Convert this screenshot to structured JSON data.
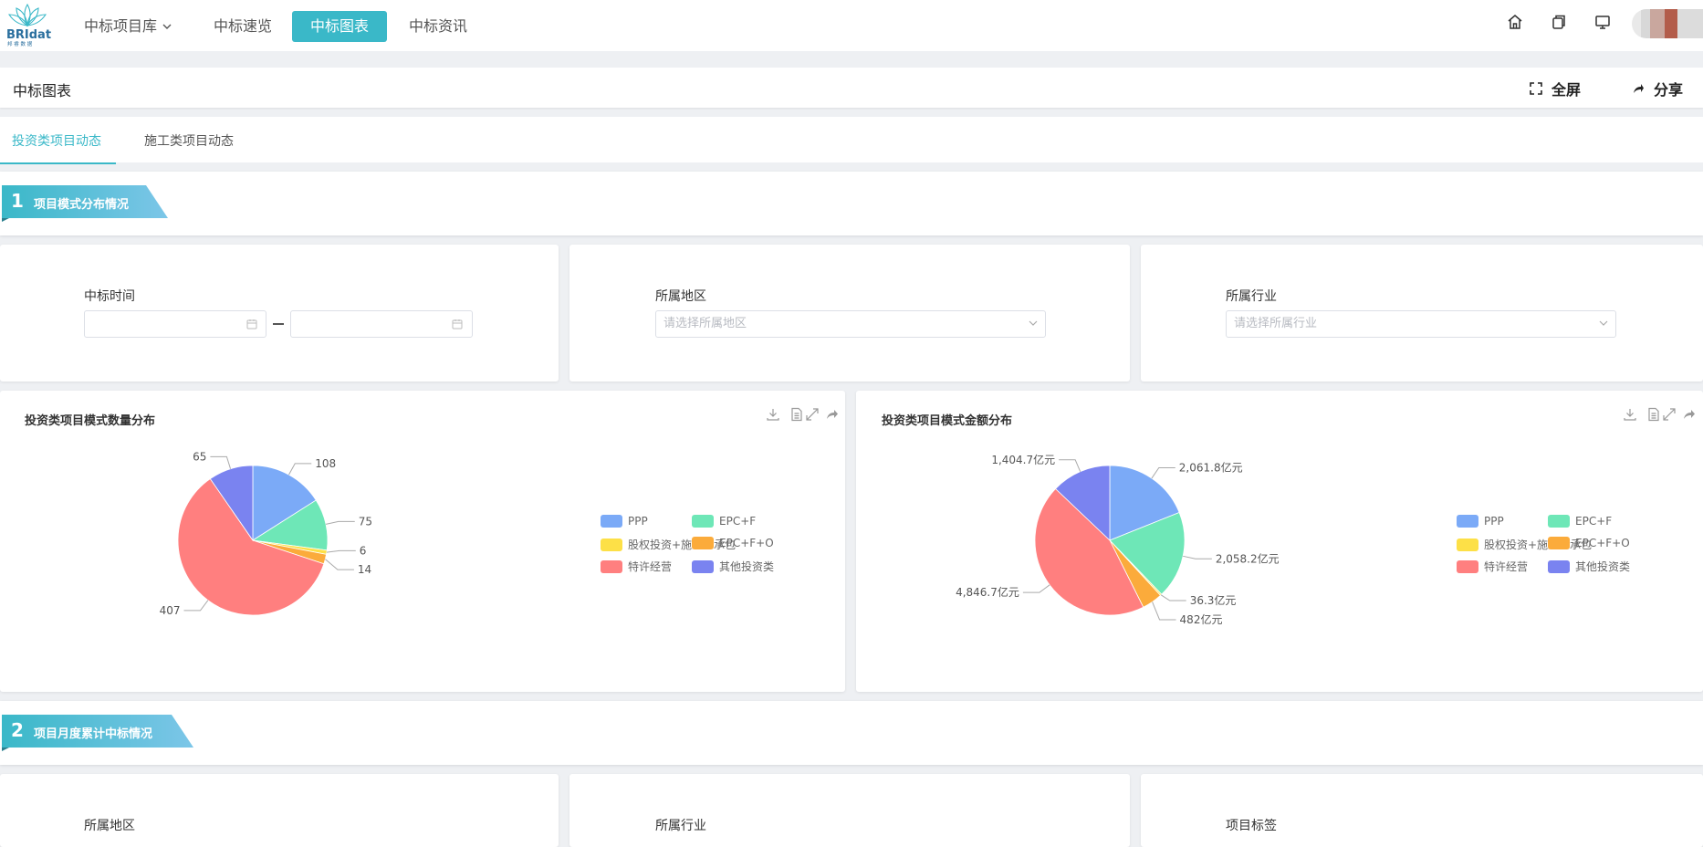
{
  "logo": {
    "text": "BRIdata",
    "subtext": "邦 睿 数 据"
  },
  "nav": {
    "items": [
      {
        "label": "中标项目库",
        "has_caret": true
      },
      {
        "label": "中标速览"
      },
      {
        "label": "中标图表",
        "active": true
      },
      {
        "label": "中标资讯"
      }
    ],
    "right_icons": [
      "home-icon",
      "copy-icon",
      "monitor-icon"
    ],
    "accent": "#3ab8c8"
  },
  "header": {
    "title": "中标图表",
    "fullscreen_label": "全屏",
    "share_label": "分享"
  },
  "tabs": [
    {
      "label": "投资类项目动态",
      "active": true
    },
    {
      "label": "施工类项目动态"
    }
  ],
  "sections": [
    {
      "num": "1",
      "title": "项目模式分布情况"
    },
    {
      "num": "2",
      "title": "项目月度累计中标情况"
    }
  ],
  "filters1": {
    "time_label": "中标时间",
    "start_value": "",
    "end_value": "",
    "region_label": "所属地区",
    "region_placeholder": "请选择所属地区",
    "industry_label": "所属行业",
    "industry_placeholder": "请选择所属行业"
  },
  "filters2": {
    "region_label": "所属地区",
    "industry_label": "所属行业",
    "tag_label": "项目标签"
  },
  "chart_data": [
    {
      "type": "pie",
      "title": "投资类项目模式数量分布",
      "categories": [
        "PPP",
        "EPC+F",
        "股权投资+施工总承包",
        "EPC+F+O",
        "特许经营",
        "其他投资类"
      ],
      "values": [
        108,
        75,
        6,
        14,
        407,
        65
      ],
      "labels": [
        "108",
        "75",
        "6",
        "14",
        "407",
        "65"
      ],
      "colors": [
        "#7baaf7",
        "#6ee7b7",
        "#fde047",
        "#fbab3b",
        "#ff7f7f",
        "#7a83f0"
      ],
      "legend": "right"
    },
    {
      "type": "pie",
      "title": "投资类项目模式金额分布",
      "categories": [
        "PPP",
        "EPC+F",
        "股权投资+施工总承包",
        "EPC+F+O",
        "特许经营",
        "其他投资类"
      ],
      "values": [
        2061.8,
        2058.2,
        36.3,
        482,
        4846.7,
        1404.7
      ],
      "labels": [
        "2,061.8亿元",
        "2,058.2亿元",
        "36.3亿元",
        "482亿元",
        "4,846.7亿元",
        "1,404.7亿元"
      ],
      "colors": [
        "#7baaf7",
        "#6ee7b7",
        "#fde047",
        "#fbab3b",
        "#ff7f7f",
        "#7a83f0"
      ],
      "legend": "right"
    }
  ]
}
